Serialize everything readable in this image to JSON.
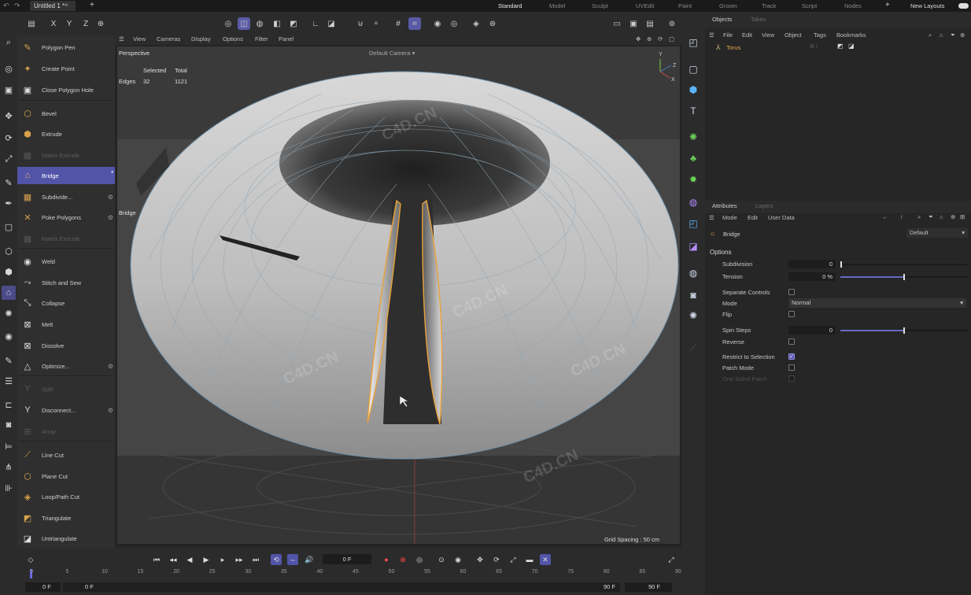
{
  "titlebar": {
    "doc_tab": "Untitled 1 *",
    "layouts": [
      "Standard",
      "Model",
      "Sculpt",
      "UVEdit",
      "Paint",
      "Groom",
      "Track",
      "Script",
      "Nodes"
    ],
    "new_layouts": "New Layouts"
  },
  "toolbar": {
    "axes": [
      "X",
      "Y",
      "Z"
    ]
  },
  "palette": {
    "items": [
      {
        "label": "Polygon Pen",
        "icon": "polygon-pen-icon",
        "glyph": "✎"
      },
      {
        "label": "Create Point",
        "icon": "create-point-icon",
        "glyph": "✦"
      },
      {
        "label": "Close Polygon Hole",
        "icon": "close-polygon-hole-icon",
        "glyph": "▣"
      },
      {
        "label": "Bevel",
        "icon": "bevel-icon",
        "glyph": "⬡"
      },
      {
        "label": "Extrude",
        "icon": "extrude-icon",
        "glyph": "⬢"
      },
      {
        "label": "Matrix Extrude",
        "icon": "matrix-extrude-icon",
        "glyph": "▦"
      },
      {
        "label": "Bridge",
        "icon": "bridge-icon",
        "glyph": "⌂"
      },
      {
        "label": "Subdivide...",
        "icon": "subdivide-icon",
        "glyph": "▦"
      },
      {
        "label": "Poke Polygons",
        "icon": "poke-polygons-icon",
        "glyph": "✕"
      },
      {
        "label": "Weld",
        "icon": "weld-icon",
        "glyph": "◉"
      },
      {
        "label": "Stitch and Sew",
        "icon": "stitch-and-sew-icon",
        "glyph": "⤳"
      },
      {
        "label": "Collapse",
        "icon": "collapse-icon",
        "glyph": "⤡"
      },
      {
        "label": "Melt",
        "icon": "melt-icon",
        "glyph": "⊠"
      },
      {
        "label": "Dissolve",
        "icon": "dissolve-icon",
        "glyph": "⊠"
      },
      {
        "label": "Optimize...",
        "icon": "optimize-icon",
        "glyph": "△"
      },
      {
        "label": "Split",
        "icon": "split-icon",
        "glyph": "Y"
      },
      {
        "label": "Disconnect...",
        "icon": "disconnect-icon",
        "glyph": "Y"
      },
      {
        "label": "Array",
        "icon": "array-icon",
        "glyph": "⊞"
      },
      {
        "label": "Line Cut",
        "icon": "line-cut-icon",
        "glyph": "⟋"
      },
      {
        "label": "Plane Cut",
        "icon": "plane-cut-icon",
        "glyph": "⬡"
      },
      {
        "label": "Loop/Path Cut",
        "icon": "loop-path-cut-icon",
        "glyph": "◈"
      },
      {
        "label": "Triangulate",
        "icon": "triangulate-icon",
        "glyph": "◩"
      },
      {
        "label": "Untriangulate",
        "icon": "untriangulate-icon",
        "glyph": "◪"
      }
    ]
  },
  "viewport_menu": {
    "items": [
      "View",
      "Cameras",
      "Display",
      "Options",
      "Filter",
      "Panel"
    ]
  },
  "viewport": {
    "name": "Perspective",
    "camera": "Default Camera",
    "stats": {
      "selected_header": "Selected",
      "total_header": "Total",
      "row_label": "Edges",
      "selected": "32",
      "total": "1121"
    },
    "hud_label": "Bridge",
    "grid_spacing": "Grid Spacing : 50 cm",
    "watermark": "C4D.CN"
  },
  "timeline": {
    "frame_field": "0 F",
    "ruler_ticks": [
      "0",
      "5",
      "10",
      "15",
      "20",
      "25",
      "30",
      "35",
      "40",
      "45",
      "50",
      "55",
      "60",
      "65",
      "70",
      "75",
      "80",
      "85",
      "90"
    ],
    "start_a": "0 F",
    "start_b": "0 F",
    "end_a": "90 F",
    "end_b": "90 F"
  },
  "objects_panel": {
    "tabs": [
      "Objects",
      "Takes"
    ],
    "menu": [
      "File",
      "Edit",
      "View",
      "Object",
      "Tags",
      "Bookmarks"
    ],
    "object_name": "Torus"
  },
  "attributes_panel": {
    "tabs": [
      "Attributes",
      "Layers"
    ],
    "menu": [
      "Mode",
      "Edit",
      "User Data"
    ],
    "tool_name": "Bridge",
    "preset": "Default",
    "section": "Options",
    "subdivision": {
      "label": "Subdivision",
      "value": "0",
      "slider": 0
    },
    "tension": {
      "label": "Tension",
      "value": "0 %",
      "slider": 0.5
    },
    "separate_controls": {
      "label": "Separate Controls",
      "checked": false
    },
    "mode": {
      "label": "Mode",
      "value": "Normal"
    },
    "flip": {
      "label": "Flip",
      "checked": false
    },
    "spin_steps": {
      "label": "Spin Steps",
      "value": "0",
      "slider": 0.5
    },
    "reverse": {
      "label": "Reverse",
      "checked": false
    },
    "restrict": {
      "label": "Restrict to Selection",
      "checked": true
    },
    "patch_mode": {
      "label": "Patch Mode",
      "checked": false
    },
    "one_sided": {
      "label": "One Sided Patch",
      "checked": false
    }
  },
  "colors": {
    "accent": "#5254a8",
    "selection_edge": "#e8a23a",
    "panel_bg": "#2f2f2f",
    "viewport_bg": "#3c3c3c"
  }
}
